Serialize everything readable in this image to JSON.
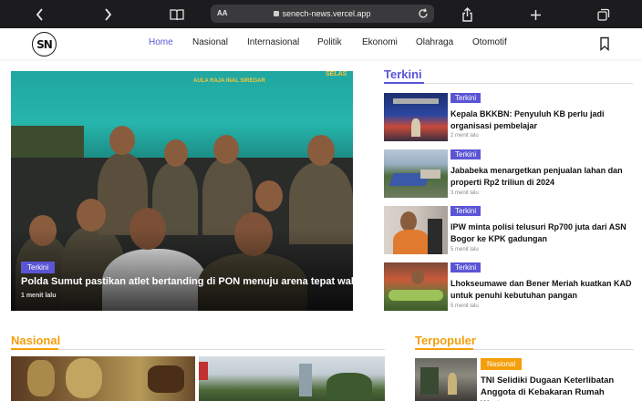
{
  "browser": {
    "url_aa": "AA",
    "url": "senech-news.vercel.app"
  },
  "header": {
    "logo_text": "SN",
    "nav": [
      {
        "label": "Home",
        "active": true
      },
      {
        "label": "Nasional",
        "active": false
      },
      {
        "label": "Internasional",
        "active": false
      },
      {
        "label": "Politik",
        "active": false
      },
      {
        "label": "Ekonomi",
        "active": false
      },
      {
        "label": "Olahraga",
        "active": false
      },
      {
        "label": "Otomotif",
        "active": false
      }
    ]
  },
  "hero": {
    "banner_text": "AULA RAJA INAL SIREGAR",
    "banner_right": "SELAS",
    "badge": "Terkini",
    "title": "Polda Sumut pastikan atlet bertanding di PON menuju arena tepat waktu",
    "time": "1 menit lalu"
  },
  "terkini": {
    "title": "Terkini",
    "accent_color": "#5b55d6",
    "items": [
      {
        "badge": "Terkini",
        "title": "Kepala BKKBN: Penyuluh KB perlu jadi organisasi pembelajar",
        "time": "2 menit lalu"
      },
      {
        "badge": "Terkini",
        "title": "Jababeka menargetkan penjualan lahan dan properti Rp2 triliun di 2024",
        "time": "3 menit lalu"
      },
      {
        "badge": "Terkini",
        "title": "IPW minta polisi telusuri Rp700 juta dari ASN Bogor ke KPK gadungan",
        "time": "5 menit lalu"
      },
      {
        "badge": "Terkini",
        "title": "Lhokseumawe dan Bener Meriah kuatkan KAD untuk penuhi kebutuhan pangan",
        "time": "5 menit lalu"
      }
    ]
  },
  "nasional": {
    "title": "Nasional",
    "accent_color": "#f59e0b"
  },
  "terpopuler": {
    "title": "Terpopuler",
    "accent_color": "#f59e0b",
    "item": {
      "badge": "Nasional",
      "title": "TNI Selidiki Dugaan Keterlibatan Anggota di Kebakaran Rumah Wartawan"
    }
  }
}
